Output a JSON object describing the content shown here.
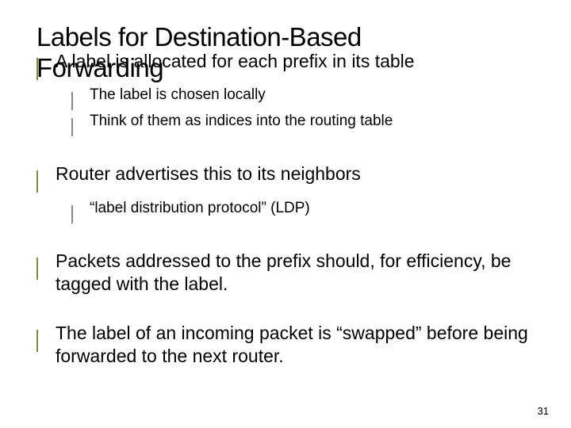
{
  "title_line1": "Labels for Destination-Based",
  "title_line2": "Forwarding",
  "bullets": {
    "b1_1": "A label is allocated for each prefix in its table",
    "b2_1": "The label is chosen locally",
    "b2_2": "Think of them as indices into the routing table",
    "b1_2": "Router advertises this to its neighbors",
    "b2_3": "“label distribution protocol” (LDP)",
    "b1_3": "Packets addressed to the prefix should, for efficiency, be tagged with the label.",
    "b1_4": "The label of an incoming packet is “swapped” before being forwarded to the next router."
  },
  "slide_number": "31"
}
